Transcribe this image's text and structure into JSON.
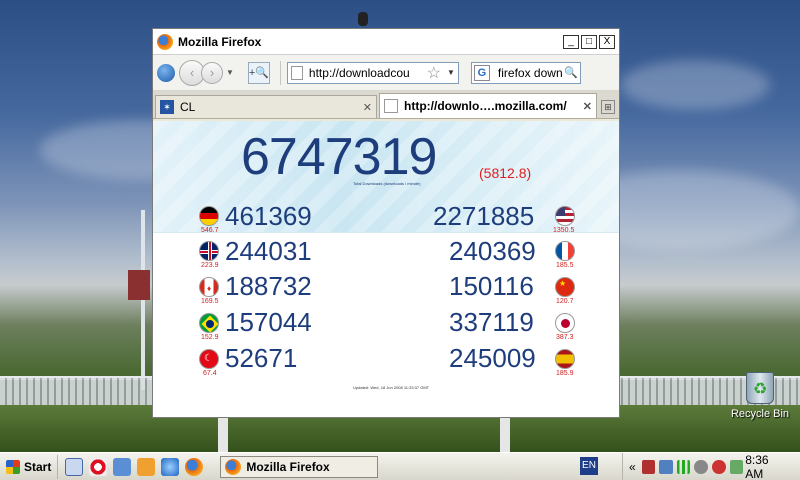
{
  "window": {
    "title": "Mozilla Firefox",
    "min": "_",
    "max": "□",
    "close": "X"
  },
  "navbar": {
    "back": "‹",
    "forward": "›",
    "url": "http://downloadcou",
    "search_text": "firefox down",
    "search_engine": "G",
    "zoom": "+🔍"
  },
  "tabs": [
    {
      "label": "CL",
      "close": "✕"
    },
    {
      "label": "http://downlo….mozilla.com/",
      "close": "✕"
    }
  ],
  "page": {
    "total": "6747319",
    "total_rate": "(5812.8)",
    "total_caption": "Total Downloads (downloads / minute)",
    "updated": "Updated: Wed, 18 Jun 2008 11:33:37 GMT",
    "countries": [
      {
        "flag": "germany-flag",
        "count": "461369",
        "rate": "546.7"
      },
      {
        "flag": "usa-flag",
        "count": "2271885",
        "rate": "1350.5"
      },
      {
        "flag": "uk-flag",
        "count": "244031",
        "rate": "223.9"
      },
      {
        "flag": "france-flag",
        "count": "240369",
        "rate": "185.5"
      },
      {
        "flag": "canada-flag",
        "count": "188732",
        "rate": "169.5"
      },
      {
        "flag": "china-flag",
        "count": "150116",
        "rate": "120.7"
      },
      {
        "flag": "brazil-flag",
        "count": "157044",
        "rate": "152.9"
      },
      {
        "flag": "japan-flag",
        "count": "337119",
        "rate": "387.3"
      },
      {
        "flag": "turkey-flag",
        "count": "52671",
        "rate": "67.4"
      },
      {
        "flag": "spain-flag",
        "count": "245009",
        "rate": "185.9"
      }
    ]
  },
  "desktop": {
    "recycle_bin": "Recycle Bin"
  },
  "taskbar": {
    "start": "Start",
    "task": "Mozilla Firefox",
    "lang": "EN",
    "chevron": "«",
    "clock": "8:36 AM"
  },
  "colors": {
    "number_blue": "#1e3d7c",
    "rate_red": "#e02020"
  }
}
